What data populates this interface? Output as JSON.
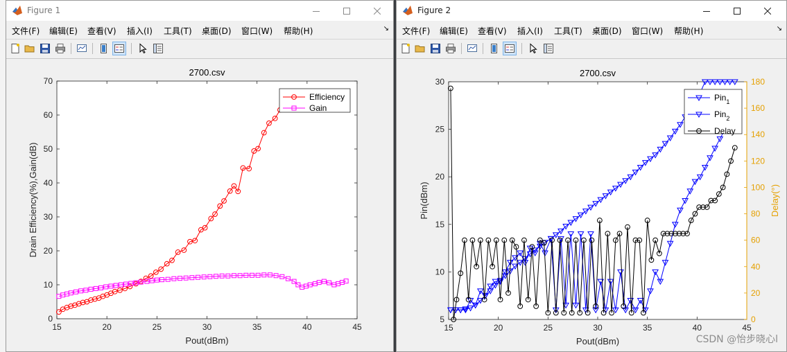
{
  "figures": [
    {
      "window_title": "Figure 1",
      "menu": [
        "文件(F)",
        "编辑(E)",
        "查看(V)",
        "插入(I)",
        "工具(T)",
        "桌面(D)",
        "窗口(W)",
        "帮助(H)"
      ]
    },
    {
      "window_title": "Figure 2",
      "menu": [
        "文件(F)",
        "编辑(E)",
        "查看(V)",
        "插入(I)",
        "工具(T)",
        "桌面(D)",
        "窗口(W)",
        "帮助(H)"
      ]
    }
  ],
  "toolbar_icons": [
    "new-figure-icon",
    "open-folder-icon",
    "save-icon",
    "print-icon",
    "link-plot-icon",
    "colorbar-icon",
    "legend-icon",
    "pointer-icon",
    "property-editor-icon"
  ],
  "watermark": "CSDN @怡步晓心l",
  "chart_data": [
    {
      "type": "line",
      "title": "2700.csv",
      "xlabel": "Pout(dBm)",
      "ylabel": "Drain Efficiency(%),Gain(dB)",
      "xlim": [
        15,
        45
      ],
      "ylim": [
        0,
        70
      ],
      "xticks": [
        15,
        20,
        25,
        30,
        35,
        40,
        45
      ],
      "yticks": [
        0,
        10,
        20,
        30,
        40,
        50,
        60,
        70
      ],
      "legend_position": "top-right",
      "series": [
        {
          "name": "Efficiency",
          "color": "#ff0000",
          "marker": "circle",
          "x": [
            15.2,
            15.6,
            16.0,
            16.4,
            16.8,
            17.2,
            17.6,
            18.0,
            18.4,
            18.8,
            19.2,
            19.6,
            20.0,
            20.4,
            20.8,
            21.3,
            21.8,
            22.3,
            22.9,
            23.4,
            23.9,
            24.4,
            24.9,
            25.4,
            26.0,
            26.5,
            27.1,
            27.7,
            28.3,
            28.8,
            29.4,
            29.8,
            30.4,
            30.8,
            31.3,
            31.7,
            32.3,
            32.7,
            33.1,
            33.6,
            34.2,
            34.7,
            35.1,
            35.7,
            36.2,
            36.8,
            37.3,
            37.9,
            38.5
          ],
          "y": [
            2.0,
            2.8,
            3.3,
            3.7,
            4.0,
            4.4,
            4.8,
            5.0,
            5.5,
            5.8,
            6.1,
            6.6,
            7.0,
            7.5,
            8.0,
            8.4,
            8.9,
            9.5,
            10.3,
            11.0,
            11.9,
            12.6,
            13.7,
            14.6,
            16.2,
            17.2,
            19.6,
            20.2,
            22.7,
            23.0,
            26.2,
            26.8,
            29.5,
            30.8,
            33.2,
            34.7,
            37.6,
            39.1,
            37.5,
            44.4,
            44.2,
            49.4,
            50.1,
            54.8,
            57.6,
            59.0,
            61.5,
            63.0,
            64.5
          ]
        },
        {
          "name": "Gain",
          "color": "#ff00ff",
          "marker": "square",
          "x": [
            15.2,
            15.6,
            16.0,
            16.4,
            16.9,
            17.4,
            17.9,
            18.4,
            18.9,
            19.4,
            19.9,
            20.4,
            20.9,
            21.4,
            21.9,
            22.4,
            22.9,
            23.4,
            24.0,
            24.5,
            25.0,
            25.5,
            26.1,
            26.7,
            27.3,
            27.9,
            28.5,
            29.1,
            29.7,
            30.3,
            30.9,
            31.5,
            32.1,
            32.7,
            33.3,
            33.9,
            34.5,
            35.1,
            35.7,
            36.3,
            36.9,
            37.5,
            38.1,
            38.7,
            39.1,
            39.5,
            39.9,
            40.3,
            40.8,
            41.2,
            41.7,
            42.2,
            42.7,
            43.1,
            43.5,
            43.9
          ],
          "y": [
            6.6,
            7.0,
            7.3,
            7.6,
            7.9,
            8.2,
            8.4,
            8.7,
            8.9,
            9.1,
            9.4,
            9.6,
            9.8,
            10.0,
            10.2,
            10.4,
            10.6,
            10.8,
            11.0,
            11.2,
            11.4,
            11.5,
            11.6,
            11.8,
            11.9,
            12.0,
            12.1,
            12.2,
            12.3,
            12.4,
            12.5,
            12.6,
            12.6,
            12.7,
            12.7,
            12.8,
            12.8,
            12.8,
            12.9,
            12.9,
            12.7,
            12.4,
            11.8,
            11.0,
            10.0,
            9.3,
            9.6,
            10.0,
            10.3,
            10.7,
            11.0,
            10.6,
            10.0,
            10.3,
            10.7,
            11.1
          ]
        }
      ]
    },
    {
      "type": "line",
      "title": "2700.csv",
      "xlabel": "Pout(dBm)",
      "ylabel": "Pin(dBm)",
      "ylabel_right": "Delay(°)",
      "xlim": [
        15,
        45
      ],
      "ylim": [
        5,
        30
      ],
      "ylim_right": [
        0,
        180
      ],
      "xticks": [
        15,
        20,
        25,
        30,
        35,
        40,
        45
      ],
      "yticks": [
        5,
        10,
        15,
        20,
        25,
        30
      ],
      "yticks_right": [
        0,
        20,
        40,
        60,
        80,
        100,
        120,
        140,
        160,
        180
      ],
      "legend_position": "top-right",
      "series": [
        {
          "name": "Pin",
          "subscript": "1",
          "color": "#0000ff",
          "marker": "triangle-down",
          "axis": "left",
          "x": [
            15.2,
            15.7,
            16.2,
            16.7,
            17.2,
            17.7,
            18.2,
            18.7,
            19.2,
            19.7,
            20.2,
            20.7,
            21.2,
            21.7,
            22.2,
            22.7,
            23.2,
            23.7,
            24.2,
            24.7,
            25.3,
            25.8,
            26.3,
            26.8,
            27.3,
            27.8,
            28.3,
            28.8,
            29.3,
            29.8,
            30.3,
            30.8,
            31.3,
            31.8,
            32.3,
            32.8,
            33.3,
            33.8,
            34.3,
            34.8,
            35.3,
            35.8,
            36.3,
            36.8,
            37.3,
            37.8,
            38.3,
            38.8,
            39.3,
            39.8,
            40.3,
            40.8,
            41.3,
            41.8,
            42.3,
            42.8,
            43.3,
            43.8
          ],
          "y": [
            6.0,
            6.0,
            6.0,
            6.1,
            6.2,
            6.5,
            7.0,
            7.5,
            8.0,
            8.6,
            9.1,
            9.6,
            10.1,
            10.6,
            11.0,
            11.4,
            11.9,
            12.3,
            12.7,
            13.1,
            13.5,
            13.9,
            14.3,
            14.8,
            15.2,
            15.6,
            16.0,
            16.4,
            16.8,
            17.2,
            17.6,
            18.0,
            18.4,
            18.8,
            19.2,
            19.6,
            20.0,
            20.5,
            21.0,
            21.5,
            21.9,
            22.3,
            22.9,
            23.5,
            24.1,
            24.8,
            25.5,
            26.3,
            27.1,
            27.9,
            28.8,
            30.0,
            30.0,
            30.0,
            30.0,
            30.0,
            30.0,
            30.0
          ]
        },
        {
          "name": "Pin",
          "subscript": "2",
          "color": "#0000ff",
          "marker": "triangle-down",
          "axis": "left",
          "x": [
            15.2,
            15.7,
            16.2,
            16.7,
            17.2,
            17.7,
            18.2,
            18.7,
            19.2,
            19.7,
            20.2,
            20.7,
            21.2,
            21.7,
            22.2,
            22.7,
            23.2,
            23.7,
            24.2,
            24.7,
            25.3,
            25.8,
            26.3,
            26.8,
            27.3,
            27.8,
            28.3,
            28.8,
            29.3,
            29.8,
            30.3,
            30.8,
            31.3,
            31.8,
            32.3,
            32.8,
            33.3,
            33.8,
            34.3,
            34.8,
            35.3,
            35.8,
            36.3,
            36.8,
            37.3,
            37.8,
            38.3,
            38.8,
            39.3,
            39.8,
            40.3,
            40.8,
            41.3,
            41.8,
            42.3,
            42.8,
            43.3
          ],
          "y": [
            6.0,
            6.0,
            6.0,
            6.0,
            7.0,
            6.5,
            8.0,
            7.5,
            8.5,
            9.0,
            9.0,
            10.0,
            11.0,
            11.5,
            12.0,
            11.0,
            12.5,
            12.0,
            13.0,
            12.0,
            13.5,
            6.0,
            13.5,
            6.5,
            14.0,
            6.5,
            14.0,
            6.0,
            14.0,
            6.0,
            9.0,
            6.0,
            9.0,
            6.0,
            10.0,
            6.0,
            7.0,
            6.0,
            7.0,
            6.0,
            8.0,
            10.0,
            9.0,
            11.0,
            13.0,
            15.0,
            16.5,
            17.5,
            18.5,
            19.5,
            20.0,
            21.0,
            22.0,
            23.0,
            24.0,
            25.0,
            26.0
          ]
        },
        {
          "name": "Delay",
          "color": "#000000",
          "marker": "circle",
          "axis": "right",
          "x": [
            15.2,
            15.5,
            15.8,
            16.2,
            16.6,
            17.0,
            17.4,
            17.8,
            18.2,
            18.6,
            19.0,
            19.4,
            19.8,
            20.2,
            20.6,
            21.0,
            21.4,
            21.8,
            22.2,
            22.6,
            23.0,
            23.4,
            23.8,
            24.2,
            24.6,
            25.0,
            25.4,
            25.8,
            26.2,
            26.6,
            27.0,
            27.4,
            27.8,
            28.2,
            28.6,
            29.0,
            29.4,
            29.8,
            30.2,
            30.6,
            31.0,
            31.4,
            31.8,
            32.2,
            32.6,
            33.0,
            33.4,
            33.8,
            34.2,
            34.6,
            35.0,
            35.4,
            35.8,
            36.2,
            36.6,
            37.0,
            37.4,
            37.8,
            38.2,
            38.6,
            39.0,
            39.4,
            39.8,
            40.2,
            40.6,
            41.0,
            41.4,
            41.8,
            42.2,
            42.6,
            43.0,
            43.4,
            43.8
          ],
          "y": [
            175,
            0,
            15,
            35,
            60,
            15,
            60,
            40,
            60,
            15,
            60,
            40,
            60,
            15,
            60,
            20,
            60,
            55,
            10,
            60,
            15,
            55,
            10,
            60,
            58,
            5,
            60,
            5,
            60,
            5,
            60,
            5,
            60,
            5,
            60,
            5,
            60,
            10,
            75,
            5,
            65,
            5,
            60,
            65,
            10,
            70,
            5,
            60,
            60,
            5,
            75,
            45,
            60,
            50,
            65,
            65,
            65,
            65,
            65,
            65,
            65,
            75,
            80,
            85,
            85,
            85,
            90,
            90,
            95,
            100,
            110,
            120,
            130
          ]
        }
      ]
    }
  ]
}
